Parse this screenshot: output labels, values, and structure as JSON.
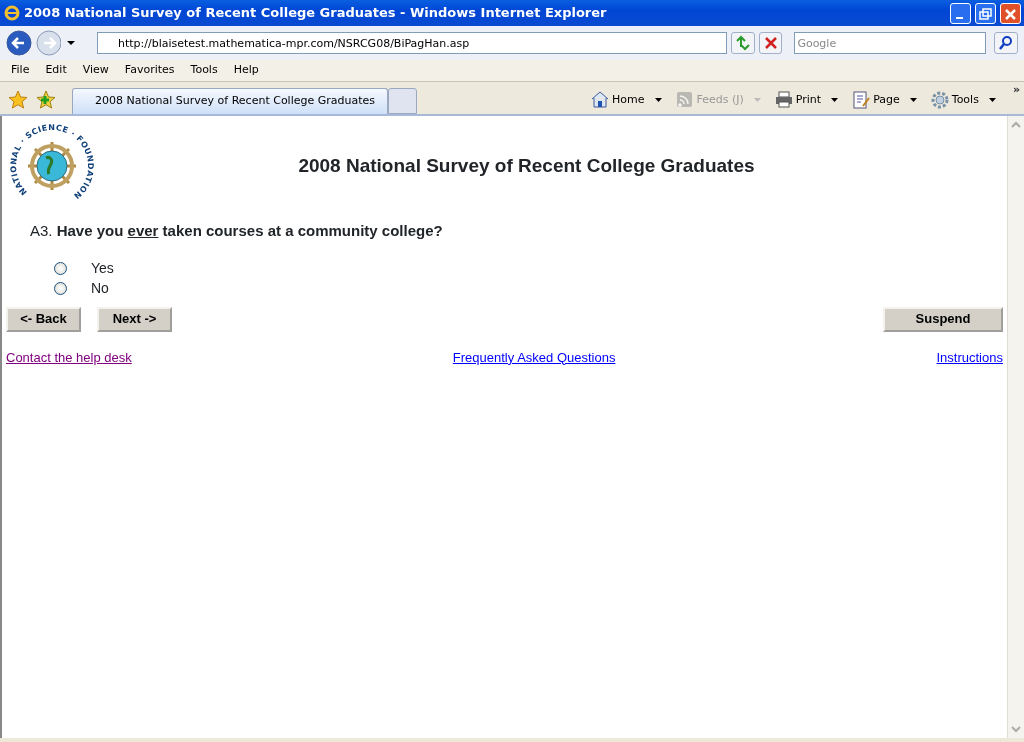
{
  "window": {
    "title": "2008 National Survey of Recent College Graduates - Windows Internet Explorer"
  },
  "address_bar": {
    "url": "http://blaisetest.mathematica-mpr.com/NSRCG08/BiPagHan.asp"
  },
  "search": {
    "placeholder": "Google"
  },
  "menu": [
    "File",
    "Edit",
    "View",
    "Favorites",
    "Tools",
    "Help"
  ],
  "tabs": [
    {
      "label": "2008 National Survey of Recent College Graduates",
      "selected": true
    }
  ],
  "command_bar": [
    {
      "label": "Home",
      "disabled": false
    },
    {
      "label": "Feeds (J)",
      "disabled": true
    },
    {
      "label": "Print",
      "disabled": false
    },
    {
      "label": "Page",
      "disabled": false
    },
    {
      "label": "Tools",
      "disabled": false
    }
  ],
  "chevron": "»",
  "page": {
    "logo_text": "NATIONAL · SCIENCE · FOUNDATION",
    "heading": "2008 National Survey of Recent College Graduates",
    "question": {
      "number": "A3.",
      "before": "Have you ",
      "underlined": "ever",
      "after": " taken courses at a community college?"
    },
    "options": [
      {
        "label": "Yes",
        "selected": false
      },
      {
        "label": "No",
        "selected": false
      }
    ],
    "buttons": [
      {
        "label": "<- Back",
        "kind": "left"
      },
      {
        "label": "Next ->",
        "kind": "left"
      },
      {
        "label": "Suspend",
        "kind": "right"
      }
    ],
    "links": [
      {
        "label": "Contact the help desk",
        "visited": true
      },
      {
        "label": "Frequently Asked Questions",
        "visited": false
      },
      {
        "label": "Instructions",
        "visited": false
      }
    ]
  }
}
